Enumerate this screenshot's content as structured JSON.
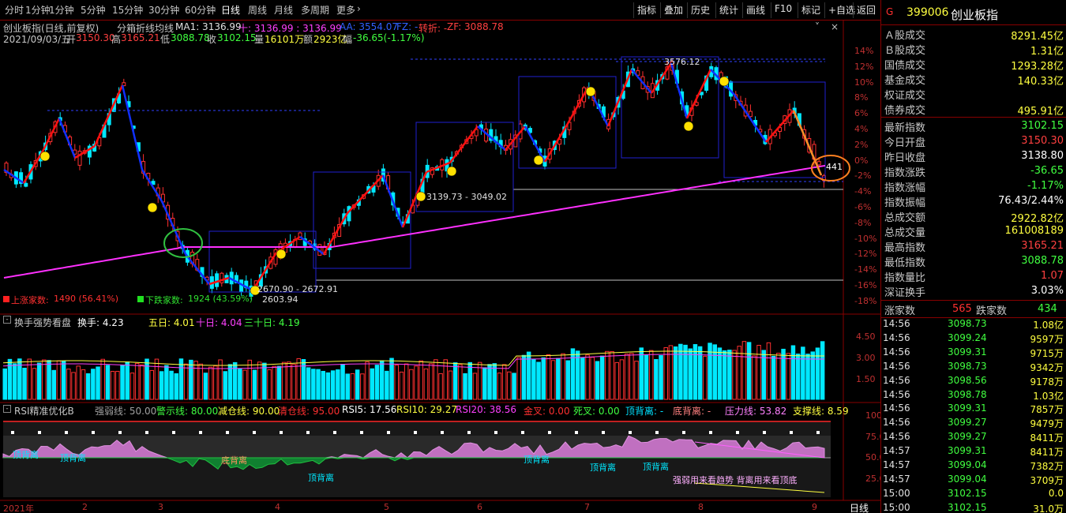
{
  "toolbar": {
    "periods": [
      "分时",
      "1分钟",
      "5分钟",
      "15分钟",
      "30分钟",
      "60分钟",
      "日线",
      "周线",
      "月线",
      "多周期",
      "更多"
    ],
    "active_period": "日线",
    "tools": [
      "指标",
      "叠加",
      "历史",
      "统计",
      "画线",
      "F10",
      "标记",
      "+自选",
      "返回"
    ]
  },
  "header": {
    "name_line": "创业板指(日线,前复权)",
    "indicator_name": "分箱折线均线",
    "ma1": "MA1: 3136.99",
    "plus": "十: 3136.99 : 3136.99",
    "aa": "AA: 3554.07",
    "fz": "FZ: -",
    "turn": "转折: -",
    "zf": "ZF: 3088.78",
    "date": "2021/09/03/五",
    "open_lbl": "开",
    "open": "3150.30",
    "high_lbl": "高",
    "high": "3165.21",
    "low_lbl": "低",
    "low": "3088.78",
    "close_lbl": "收",
    "close": "3102.15",
    "vol_lbl": "量",
    "vol": "16101万",
    "amt_lbl": "额",
    "amt": "2923亿",
    "chg_lbl": "幅",
    "chg": "-36.65(-1.17%)"
  },
  "main_axis": {
    "ticks": [
      "14%",
      "12%",
      "10%",
      "8%",
      "6%",
      "4%",
      "2%",
      "0%",
      "-2%",
      "-4%",
      "-6%",
      "-8%",
      "-10%",
      "-12%",
      "-14%",
      "-16%",
      "-18%"
    ]
  },
  "annotations": {
    "box_high": "3576.12",
    "range1": "3139.73 - 3049.02",
    "range2": "2670.90 - 2672.91",
    "low_label": "2603.94",
    "end_label": "441",
    "up_label": "上涨家数:",
    "up_text": "1490 (56.41%)",
    "down_label": "下跌家数:",
    "down_text": "1924 (43.59%)"
  },
  "turnover": {
    "title": "换手强势看盘",
    "hand": "换手: 4.23",
    "d5": "五日: 4.01",
    "d10": "十日: 4.04",
    "d30": "三十日: 4.19",
    "ticks": [
      "4.50",
      "3.00",
      "1.50"
    ]
  },
  "rsi": {
    "title": "RSI精准优化B",
    "weak": "强弱线: 50.00",
    "warn": "警示线: 80.00",
    "reduce": "减仓线: 90.00",
    "clear": "清仓线: 95.00",
    "rsi5": "RSI5: 17.56",
    "rsi10": "RSI10: 29.27",
    "rsi20": "RSI20: 38.56",
    "gold": "金叉: 0.00",
    "dead": "死叉: 0.00",
    "top_div": "顶背离: -",
    "bottom_div": "底背离: -",
    "press": "压力线: 53.82",
    "support": "支撑线: 8.59",
    "ticks": [
      "100.0",
      "75.00",
      "50.00",
      "25.00"
    ],
    "labels": [
      "顶背离",
      "顶背离",
      "底背离",
      "顶背离",
      "顶背离",
      "顶背离",
      "顶背离"
    ],
    "note": "强弱用来看趋势 背离用来看顶底"
  },
  "xaxis": {
    "labels": [
      "2021年",
      "2",
      "3",
      "4",
      "5",
      "6",
      "7",
      "8",
      "9"
    ],
    "period": "日线"
  },
  "right": {
    "code_prefix": "G",
    "code": "399006",
    "name": "创业板指",
    "stats": [
      {
        "label": "Ａ股成交",
        "value": "8291.45亿",
        "color": "#ffff40"
      },
      {
        "label": "Ｂ股成交",
        "value": "1.31亿",
        "color": "#ffff40"
      },
      {
        "label": "国债成交",
        "value": "1293.28亿",
        "color": "#ffff40"
      },
      {
        "label": "基金成交",
        "value": "140.33亿",
        "color": "#ffff40"
      },
      {
        "label": "权证成交",
        "value": "",
        "color": "#ffff40"
      },
      {
        "label": "债券成交",
        "value": "495.91亿",
        "color": "#ffff40"
      }
    ],
    "quotes": [
      {
        "label": "最新指数",
        "value": "3102.15",
        "color": "#40ff40"
      },
      {
        "label": "今日开盘",
        "value": "3150.30",
        "color": "#ff4040"
      },
      {
        "label": "昨日收盘",
        "value": "3138.80",
        "color": "#ffffff"
      },
      {
        "label": "指数涨跌",
        "value": "-36.65",
        "color": "#40ff40"
      },
      {
        "label": "指数涨幅",
        "value": "-1.17%",
        "color": "#40ff40"
      },
      {
        "label": "指数振幅",
        "value": "76.43/2.44%",
        "color": "#ffffff"
      },
      {
        "label": "总成交额",
        "value": "2922.82亿",
        "color": "#ffff40"
      },
      {
        "label": "总成交量",
        "value": "161008189",
        "color": "#ffff40"
      },
      {
        "label": "最高指数",
        "value": "3165.21",
        "color": "#ff4040"
      },
      {
        "label": "最低指数",
        "value": "3088.78",
        "color": "#40ff40"
      },
      {
        "label": "指数量比",
        "value": "1.07",
        "color": "#ff4040"
      },
      {
        "label": "深证换手",
        "value": "3.03%",
        "color": "#ffffff"
      }
    ],
    "up_label": "涨家数",
    "up_count": "565",
    "down_label": "跌家数",
    "down_count": "434",
    "ticks": [
      {
        "time": "14:56",
        "price": "3098.73",
        "vol": "1.08亿",
        "vc": "#ffff40"
      },
      {
        "time": "14:56",
        "price": "3099.24",
        "vol": "9597万",
        "vc": "#ffff40"
      },
      {
        "time": "14:56",
        "price": "3099.31",
        "vol": "9715万",
        "vc": "#ffff40"
      },
      {
        "time": "14:56",
        "price": "3098.73",
        "vol": "9342万",
        "vc": "#ffff40"
      },
      {
        "time": "14:56",
        "price": "3098.56",
        "vol": "9178万",
        "vc": "#ffff40"
      },
      {
        "time": "14:56",
        "price": "3098.78",
        "vol": "1.03亿",
        "vc": "#ffff40"
      },
      {
        "time": "14:56",
        "price": "3099.31",
        "vol": "7857万",
        "vc": "#ffff40"
      },
      {
        "time": "14:56",
        "price": "3099.27",
        "vol": "9479万",
        "vc": "#ffff40"
      },
      {
        "time": "14:56",
        "price": "3099.27",
        "vol": "8411万",
        "vc": "#ffff40"
      },
      {
        "time": "14:57",
        "price": "3099.31",
        "vol": "8411万",
        "vc": "#ffff40"
      },
      {
        "time": "14:57",
        "price": "3099.04",
        "vol": "7382万",
        "vc": "#ffff40"
      },
      {
        "time": "14:57",
        "price": "3099.04",
        "vol": "3709万",
        "vc": "#ffff40"
      },
      {
        "time": "15:00",
        "price": "3102.15",
        "vol": "0.0",
        "vc": "#ffff40"
      },
      {
        "time": "15:00",
        "price": "3102.15",
        "vol": "31.0万",
        "vc": "#ffff40"
      }
    ]
  },
  "colors": {
    "up": "#ff3030",
    "down": "#00e8ff",
    "ma_line": "#ff30ff",
    "trend_up": "#ff1010",
    "trend_down": "#1030ff",
    "box": "#2020d0",
    "axis_red": "#c00000"
  }
}
